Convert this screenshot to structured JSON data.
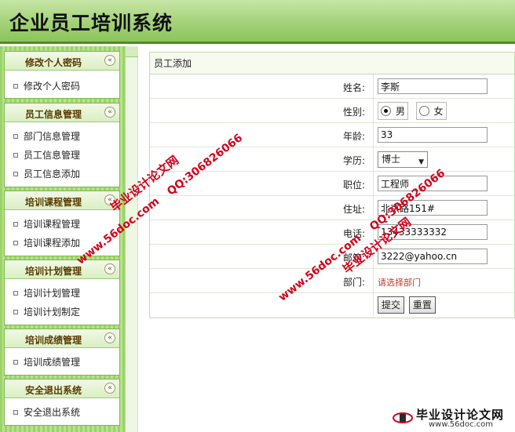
{
  "app": {
    "title": "企业员工培训系统"
  },
  "sidebar": {
    "panels": [
      {
        "title": "修改个人密码",
        "items": [
          "修改个人密码"
        ]
      },
      {
        "title": "员工信息管理",
        "items": [
          "部门信息管理",
          "员工信息管理",
          "员工信息添加"
        ]
      },
      {
        "title": "培训课程管理",
        "items": [
          "培训课程管理",
          "培训课程添加"
        ]
      },
      {
        "title": "培训计划管理",
        "items": [
          "培训计划管理",
          "培训计划制定"
        ]
      },
      {
        "title": "培训成绩管理",
        "items": [
          "培训成绩管理"
        ]
      },
      {
        "title": "安全退出系统",
        "items": [
          "安全退出系统"
        ]
      }
    ],
    "toggle_glyph": "«"
  },
  "form": {
    "heading": "员工添加",
    "name_label": "姓名:",
    "name_value": "李斯",
    "gender_label": "性别:",
    "gender_male": "男",
    "gender_female": "女",
    "age_label": "年龄:",
    "age_value": "33",
    "edu_label": "学历:",
    "edu_value": "博士",
    "position_label": "职位:",
    "position_value": "工程师",
    "address_label": "住址:",
    "address_value": "北京路151#",
    "phone_label": "电话:",
    "phone_value": "13433333332",
    "email_label": "邮箱:",
    "email_value": "3222@yahoo.cn",
    "dept_label": "部门:",
    "dept_value": "请选择部门",
    "submit_label": "提交",
    "reset_label": "重置"
  },
  "watermarks": {
    "site": "www.56doc.com",
    "qq": "QQ:306826066",
    "name": "毕业设计论文网"
  },
  "logo": {
    "text": "毕业设计论文网",
    "url": "www.56doc.com"
  }
}
